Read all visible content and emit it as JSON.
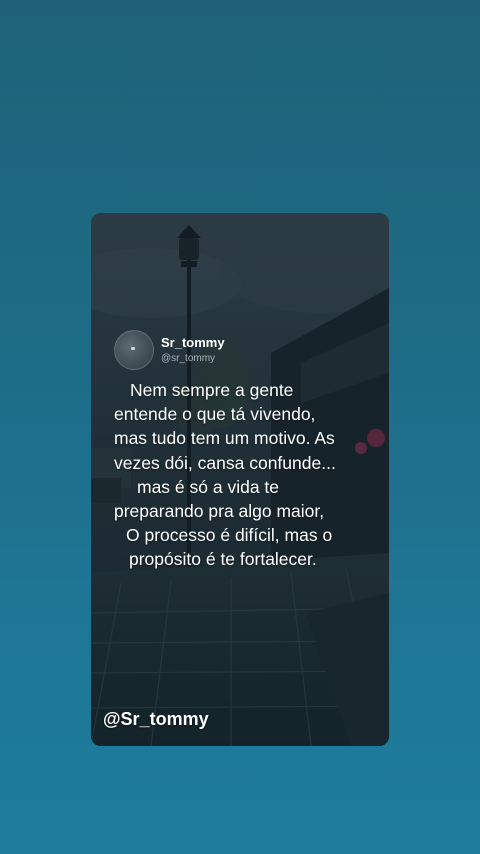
{
  "post": {
    "author": {
      "name": "Sr_tommy",
      "handle": "@sr_tommy"
    },
    "quote_lines": [
      "Nem sempre a gente",
      "entende o que tá vivendo,",
      "mas tudo tem um motivo. As",
      "vezes dói, cansa confunde...",
      "mas é só a vida te",
      "preparando pra algo maior,",
      "O processo é difícil, mas o",
      "propósito é te fortalecer."
    ],
    "footer_handle": "@Sr_tommy"
  },
  "colors": {
    "background": "#1e6e89",
    "text": "#ffffff",
    "handle": "#a8b3b8"
  }
}
